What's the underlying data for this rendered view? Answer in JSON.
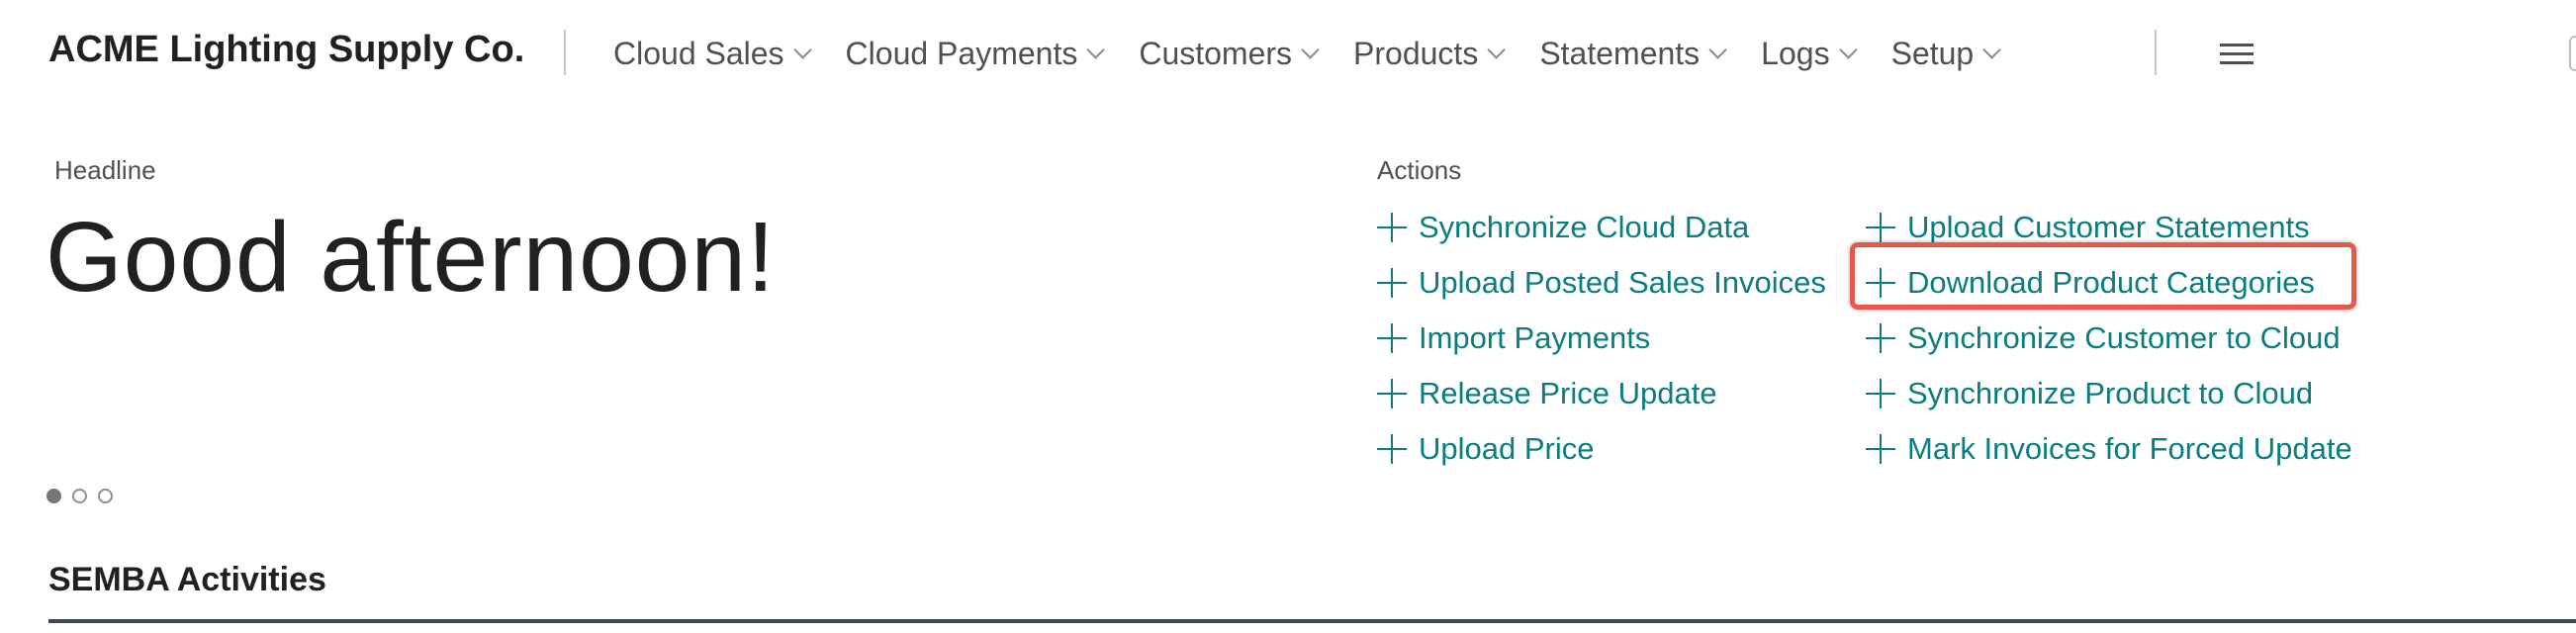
{
  "header": {
    "company": "ACME Lighting Supply Co.",
    "nav": [
      {
        "label": "Cloud Sales"
      },
      {
        "label": "Cloud Payments"
      },
      {
        "label": "Customers"
      },
      {
        "label": "Products"
      },
      {
        "label": "Statements"
      },
      {
        "label": "Logs"
      },
      {
        "label": "Setup"
      }
    ],
    "menu_icon": "hamburger-icon"
  },
  "headline": {
    "label": "Headline",
    "greeting": "Good afternoon!",
    "carousel": {
      "count": 3,
      "active": 1
    }
  },
  "actions": {
    "label": "Actions",
    "col1": [
      {
        "label": "Synchronize Cloud Data"
      },
      {
        "label": "Upload Posted Sales Invoices"
      },
      {
        "label": "Import Payments"
      },
      {
        "label": "Release Price Update"
      },
      {
        "label": "Upload Price"
      }
    ],
    "col2": [
      {
        "label": "Upload Customer Statements"
      },
      {
        "label": "Download Product Categories"
      },
      {
        "label": "Synchronize Customer to Cloud"
      },
      {
        "label": "Synchronize Product to Cloud"
      },
      {
        "label": "Mark Invoices for Forced Update"
      }
    ],
    "highlighted": "Download Product Categories"
  },
  "section": {
    "title": "SEMBA Activities"
  },
  "colors": {
    "accent": "#0a7d80",
    "highlight": "#e8574a",
    "text": "#212121"
  }
}
